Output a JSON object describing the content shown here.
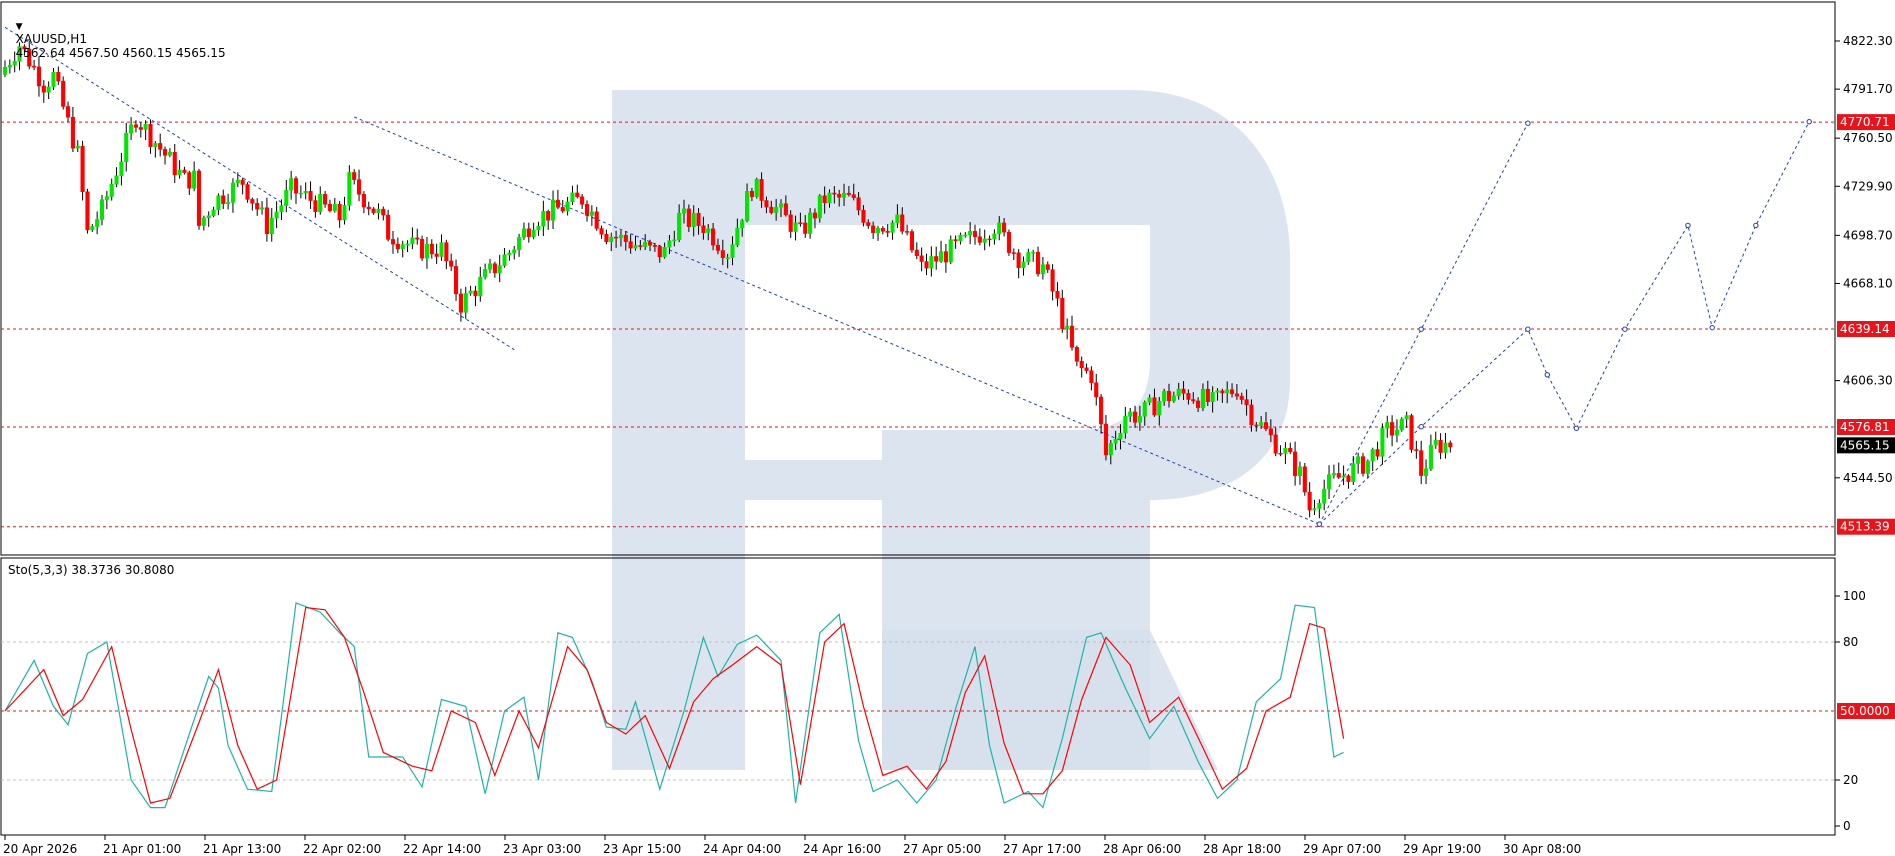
{
  "header": {
    "symbol": "XAUUSD,H1",
    "ohlc": "4562.64 4567.50 4560.15 4565.15"
  },
  "stoch_header": "Sto(5,3,3) 38.3736 30.8080",
  "colors": {
    "bull": "#00e600",
    "bear": "#ff0000",
    "level_line": "#e8141c",
    "forecast": "#1f3fbf",
    "stoch_main": "#20b2aa",
    "stoch_signal": "#ff0000",
    "watermark": "#d6e0ec"
  },
  "chart_data": [
    {
      "type": "candlestick",
      "symbol": "XAUUSD",
      "timeframe": "H1",
      "ylim": [
        4498,
        4842
      ],
      "y_ticks": [
        "4822.30",
        "4791.70",
        "4760.50",
        "4729.90",
        "4698.70",
        "4668.10",
        "4606.30",
        "4544.50"
      ],
      "x_labels": [
        "20 Apr 2026",
        "21 Apr 01:00",
        "21 Apr 13:00",
        "22 Apr 02:00",
        "22 Apr 14:00",
        "23 Apr 03:00",
        "23 Apr 15:00",
        "24 Apr 04:00",
        "24 Apr 16:00",
        "27 Apr 05:00",
        "27 Apr 17:00",
        "28 Apr 06:00",
        "28 Apr 18:00",
        "29 Apr 07:00",
        "29 Apr 19:00",
        "30 Apr 08:00"
      ],
      "current_price": "4565.15",
      "levels": [
        {
          "label": "4770.71",
          "value": 4770.71
        },
        {
          "label": "4639.14",
          "value": 4639.14
        },
        {
          "label": "4576.81",
          "value": 4576.81
        },
        {
          "label": "4513.39",
          "value": 4513.39
        }
      ],
      "trend_lines": [
        [
          [
            0,
            4831
          ],
          [
            105,
            4626
          ]
        ],
        [
          [
            72,
            4774
          ],
          [
            271,
            4515
          ]
        ]
      ],
      "forecast_paths": [
        [
          [
            271,
            4515
          ],
          [
            292,
            4639
          ],
          [
            314,
            4770
          ]
        ],
        [
          [
            271,
            4515
          ],
          [
            292,
            4577
          ],
          [
            314,
            4639
          ],
          [
            318,
            4610
          ],
          [
            324,
            4576
          ],
          [
            334,
            4639
          ],
          [
            347,
            4705
          ],
          [
            352,
            4640
          ],
          [
            361,
            4705
          ],
          [
            372,
            4771
          ]
        ]
      ],
      "anchors": [
        [
          [
            {
              "t": 0,
              "price": 4801
            }
          ]
        ],
        [
          [
            {
              "t": 4,
              "price": 4820
            }
          ],
          [
            {
              "t": 9,
              "price": 4795
            },
            {
              "t": 11,
              "price": 4800
            }
          ],
          [
            {
              "t": 16,
              "price": 4750
            },
            {
              "t": 18,
              "price": 4700
            }
          ],
          [
            {
              "t": 21,
              "price": 4715
            }
          ],
          [
            {
              "t": 28,
              "price": 4774
            }
          ],
          [
            {
              "t": 38,
              "price": 4734
            },
            {
              "t": 40,
              "price": 4735
            }
          ],
          [
            {
              "t": 41,
              "price": 4705
            },
            {
              "t": 44,
              "price": 4720
            }
          ],
          [
            {
              "t": 50,
              "price": 4733
            },
            {
              "t": 55,
              "price": 4705
            }
          ],
          [
            {
              "t": 60,
              "price": 4728
            }
          ],
          [
            {
              "t": 65,
              "price": 4720
            },
            {
              "t": 70,
              "price": 4710
            }
          ]
        ],
        [
          [
            {
              "t": 72,
              "price": 4733
            }
          ],
          [
            {
              "t": 78,
              "price": 4712
            },
            {
              "t": 80,
              "price": 4700
            }
          ],
          [
            {
              "t": 86,
              "price": 4690
            },
            {
              "t": 91,
              "price": 4690
            }
          ],
          [
            {
              "t": 95,
              "price": 4655
            }
          ],
          [
            {
              "t": 100,
              "price": 4672
            }
          ],
          [
            {
              "t": 105,
              "price": 4688
            }
          ],
          [
            {
              "t": 110,
              "price": 4709
            }
          ],
          [
            {
              "t": 120,
              "price": 4722
            }
          ],
          [
            {
              "t": 125,
              "price": 4700
            }
          ],
          [
            {
              "t": 135,
              "price": 4688
            },
            {
              "t": 137,
              "price": 4688
            }
          ],
          [
            {
              "t": 140,
              "price": 4710
            },
            {
              "t": 145,
              "price": 4705
            }
          ]
        ],
        [
          [
            {
              "t": 150,
              "price": 4688
            }
          ],
          [
            {
              "t": 155,
              "price": 4730
            },
            {
              "t": 158,
              "price": 4722
            }
          ],
          [
            {
              "t": 165,
              "price": 4700
            }
          ],
          [
            {
              "t": 170,
              "price": 4722
            },
            {
              "t": 175,
              "price": 4722
            }
          ],
          [
            {
              "t": 180,
              "price": 4705
            }
          ],
          [
            {
              "t": 185,
              "price": 4707
            },
            {
              "t": 190,
              "price": 4678
            }
          ],
          [
            {
              "t": 198,
              "price": 4693
            }
          ],
          [
            {
              "t": 205,
              "price": 4705
            }
          ],
          [
            {
              "t": 210,
              "price": 4685
            },
            {
              "t": 215,
              "price": 4679
            }
          ],
          [
            {
              "t": 218,
              "price": 4655
            },
            {
              "t": 222,
              "price": 4615
            }
          ],
          [
            {
              "t": 225,
              "price": 4610
            },
            {
              "t": 228,
              "price": 4559
            }
          ]
        ],
        [
          [
            {
              "t": 232,
              "price": 4585
            }
          ],
          [
            {
              "t": 235,
              "price": 4584
            }
          ],
          [
            {
              "t": 240,
              "price": 4596
            }
          ],
          [
            {
              "t": 245,
              "price": 4598
            }
          ],
          [
            {
              "t": 250,
              "price": 4592
            }
          ],
          [
            {
              "t": 255,
              "price": 4602
            },
            {
              "t": 258,
              "price": 4585
            }
          ],
          [
            {
              "t": 262,
              "price": 4570
            }
          ],
          [
            {
              "t": 265,
              "price": 4560
            }
          ],
          [
            {
              "t": 268,
              "price": 4547
            },
            {
              "t": 270,
              "price": 4525
            }
          ],
          [
            {
              "t": 272,
              "price": 4535
            },
            {
              "t": 275,
              "price": 4543
            }
          ],
          [
            {
              "t": 278,
              "price": 4548
            },
            {
              "t": 282,
              "price": 4555
            }
          ],
          [
            {
              "t": 286,
              "price": 4574
            }
          ],
          [
            {
              "t": 290,
              "price": 4578
            },
            {
              "t": 293,
              "price": 4548
            }
          ],
          [
            {
              "t": 296,
              "price": 4565
            },
            {
              "t": 298,
              "price": 4566
            }
          ]
        ]
      ],
      "candle_count": 299
    },
    {
      "type": "line",
      "indicator": "Stochastic",
      "params": "5,3,3",
      "ylim": [
        0,
        100
      ],
      "y_ticks": [
        "100",
        "80",
        "20",
        "0"
      ],
      "mid_level": {
        "label": "50.0000",
        "value": 50
      },
      "grid_levels": [
        80,
        20
      ],
      "series": [
        {
          "key": "main",
          "points": [
            [
              0,
              50
            ],
            [
              6,
              72
            ],
            [
              10,
              52
            ],
            [
              13,
              44
            ],
            [
              17,
              75
            ],
            [
              21,
              80
            ],
            [
              26,
              20
            ],
            [
              30,
              8
            ],
            [
              33,
              8
            ],
            [
              38,
              40
            ],
            [
              42,
              65
            ],
            [
              44,
              60
            ],
            [
              46,
              35
            ],
            [
              50,
              16
            ],
            [
              55,
              15
            ],
            [
              60,
              97
            ],
            [
              65,
              93
            ],
            [
              69,
              84
            ],
            [
              72,
              78
            ],
            [
              75,
              30
            ],
            [
              79,
              30
            ],
            [
              82,
              30
            ],
            [
              86,
              17
            ],
            [
              90,
              55
            ],
            [
              95,
              52
            ],
            [
              99,
              14
            ],
            [
              103,
              50
            ],
            [
              107,
              56
            ],
            [
              110,
              20
            ],
            [
              114,
              84
            ],
            [
              117,
              82
            ],
            [
              121,
              63
            ],
            [
              124,
              43
            ],
            [
              128,
              42
            ],
            [
              130,
              54
            ],
            [
              135,
              16
            ],
            [
              140,
              50
            ],
            [
              144,
              82
            ],
            [
              147,
              65
            ],
            [
              151,
              79
            ],
            [
              155,
              83
            ],
            [
              160,
              72
            ],
            [
              163,
              10
            ],
            [
              168,
              84
            ],
            [
              172,
              92
            ],
            [
              176,
              37
            ],
            [
              179,
              15
            ],
            [
              184,
              20
            ],
            [
              188,
              10
            ],
            [
              192,
              20
            ],
            [
              196,
              51
            ],
            [
              200,
              78
            ],
            [
              203,
              35
            ],
            [
              206,
              10
            ],
            [
              211,
              15
            ],
            [
              214,
              8
            ],
            [
              218,
              38
            ],
            [
              223,
              82
            ],
            [
              226,
              84
            ],
            [
              231,
              60
            ],
            [
              236,
              38
            ],
            [
              241,
              52
            ],
            [
              246,
              28
            ],
            [
              250,
              12
            ],
            [
              254,
              20
            ],
            [
              258,
              54
            ],
            [
              263,
              64
            ],
            [
              266,
              96
            ],
            [
              270,
              95
            ],
            [
              274,
              30
            ],
            [
              276,
              32
            ]
          ]
        },
        {
          "key": "signal",
          "points": [
            [
              0,
              50
            ],
            [
              8,
              68
            ],
            [
              12,
              48
            ],
            [
              16,
              55
            ],
            [
              22,
              78
            ],
            [
              26,
              42
            ],
            [
              30,
              10
            ],
            [
              34,
              12
            ],
            [
              40,
              45
            ],
            [
              44,
              68
            ],
            [
              48,
              35
            ],
            [
              52,
              16
            ],
            [
              56,
              20
            ],
            [
              62,
              95
            ],
            [
              66,
              94
            ],
            [
              70,
              82
            ],
            [
              74,
              58
            ],
            [
              78,
              32
            ],
            [
              84,
              26
            ],
            [
              88,
              24
            ],
            [
              92,
              50
            ],
            [
              97,
              45
            ],
            [
              101,
              22
            ],
            [
              106,
              50
            ],
            [
              110,
              34
            ],
            [
              116,
              78
            ],
            [
              120,
              68
            ],
            [
              124,
              45
            ],
            [
              128,
              40
            ],
            [
              132,
              48
            ],
            [
              137,
              25
            ],
            [
              142,
              54
            ],
            [
              146,
              64
            ],
            [
              150,
              70
            ],
            [
              155,
              78
            ],
            [
              160,
              70
            ],
            [
              164,
              18
            ],
            [
              169,
              80
            ],
            [
              173,
              88
            ],
            [
              177,
              52
            ],
            [
              181,
              22
            ],
            [
              186,
              26
            ],
            [
              190,
              16
            ],
            [
              194,
              28
            ],
            [
              198,
              58
            ],
            [
              202,
              74
            ],
            [
              206,
              36
            ],
            [
              210,
              14
            ],
            [
              214,
              14
            ],
            [
              218,
              24
            ],
            [
              222,
              55
            ],
            [
              227,
              82
            ],
            [
              232,
              70
            ],
            [
              236,
              45
            ],
            [
              242,
              56
            ],
            [
              247,
              34
            ],
            [
              251,
              16
            ],
            [
              256,
              25
            ],
            [
              260,
              50
            ],
            [
              265,
              56
            ],
            [
              269,
              88
            ],
            [
              272,
              86
            ],
            [
              276,
              38
            ]
          ]
        }
      ]
    }
  ]
}
